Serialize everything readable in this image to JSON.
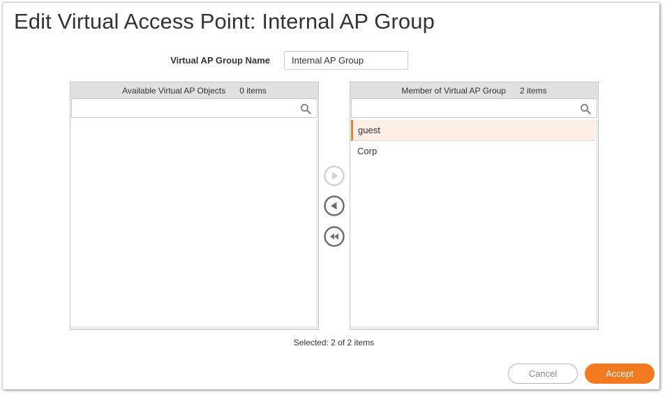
{
  "dialog": {
    "title": "Edit Virtual Access Point: Internal AP Group",
    "group_name": {
      "label": "Virtual AP Group Name",
      "value": "Internal AP Group"
    }
  },
  "available_panel": {
    "title": "Available Virtual AP Objects",
    "count": "0 items",
    "search_placeholder": "",
    "items": []
  },
  "member_panel": {
    "title": "Member of Virtual AP Group",
    "count": "2 items",
    "search_placeholder": "",
    "items": [
      {
        "label": "guest",
        "selected": true
      },
      {
        "label": "Corp",
        "selected": false
      }
    ]
  },
  "move_buttons": {
    "add_icon": "play-circle-icon",
    "remove_icon": "back-circle-icon",
    "remove_all_icon": "rewind-circle-icon"
  },
  "selection_status": "Selected: 2 of 2 items",
  "buttons": {
    "cancel_label": "Cancel",
    "accept_label": "Accept"
  },
  "colors": {
    "accent": "#f47a20",
    "selected_row_bg": "#fdeee6",
    "panel_header_bg": "#e1e1e1"
  }
}
